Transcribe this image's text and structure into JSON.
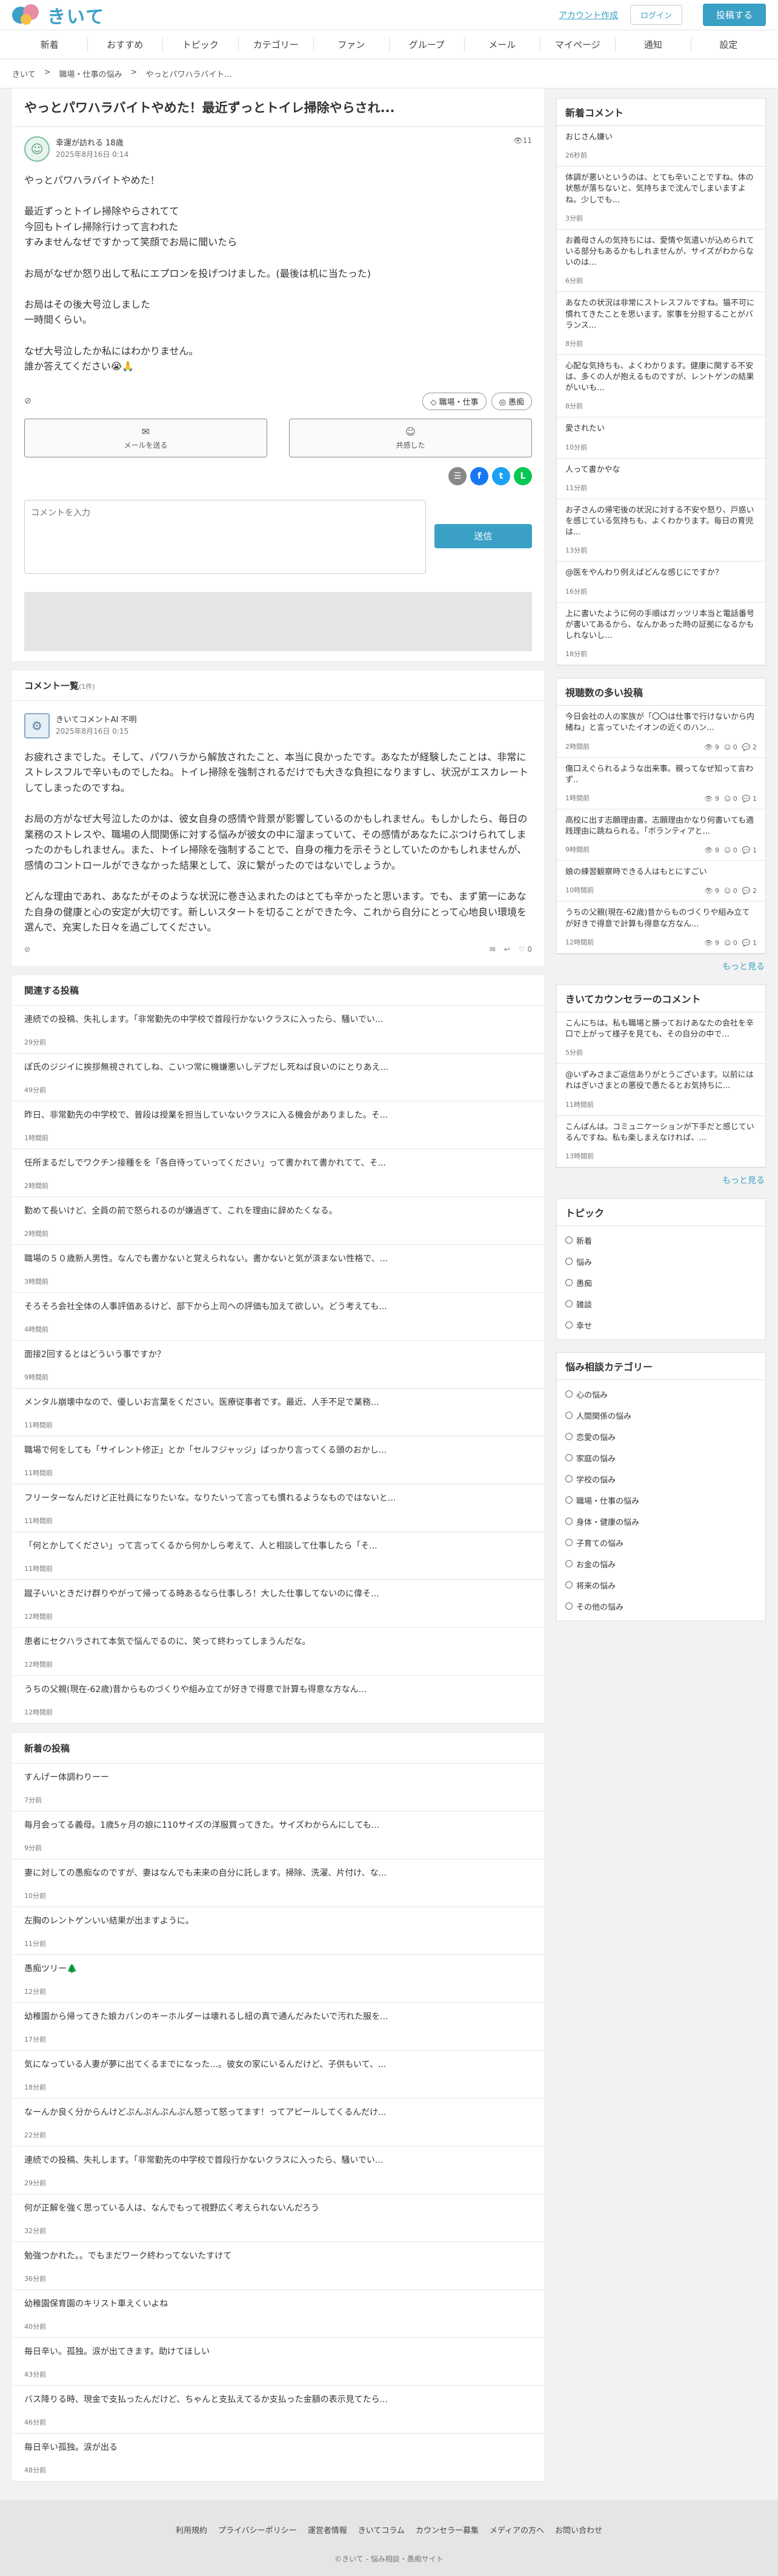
{
  "header": {
    "logo": "きいて",
    "signup": "アカウント作成",
    "login": "ログイン",
    "post": "投稿する"
  },
  "nav": [
    "新着",
    "おすすめ",
    "トピック",
    "カテゴリー",
    "ファン",
    "グループ",
    "メール",
    "マイページ",
    "通知",
    "設定"
  ],
  "breadcrumb": [
    "きいて",
    ">",
    "職場・仕事の悩み",
    ">",
    "やっとパワハラバイト..."
  ],
  "post": {
    "title": "やっとパワハラバイトやめた！最近ずっとトイレ掃除やらされ...",
    "author": "幸運が訪れる",
    "age": "18歳",
    "date": "2025年8月16日 0:14",
    "views": "11",
    "body": "やっとパワハラバイトやめた！\n\n最近ずっとトイレ掃除やらされてて\n今回もトイレ掃除行けって言われた\nすみませんなぜですかって笑顔でお局に聞いたら\n\nお局がなぜか怒り出して私にエプロンを投げつけました。(最後は机に当たった)\n\nお局はその後大号泣しました\n一時間くらい。\n\nなぜ大号泣したか私にはわかりません。\n誰か答えてください😭🙏",
    "tags": [
      "職場・仕事",
      "愚痴"
    ],
    "mail": "メールを送る",
    "empathy": "共感した",
    "placeholder": "コメントを入力",
    "send": "送信"
  },
  "comments": {
    "title": "コメント一覧",
    "count": "(1件)",
    "items": [
      {
        "author": "きいてコメントAI",
        "age": "不明",
        "date": "2025年8月16日 0:15",
        "body": "お疲れさまでした。そして、パワハラから解放されたこと、本当に良かったです。あなたが経験したことは、非常にストレスフルで辛いものでしたね。トイレ掃除を強制されるだけでも大きな負担になりますし、状況がエスカレートしてしまったのですね。\n\nお局の方がなぜ大号泣したのかは、彼女自身の感情や背景が影響しているのかもしれません。もしかしたら、毎日の業務のストレスや、職場の人間関係に対する悩みが彼女の中に溜まっていて、その感情があなたにぶつけられてしまったのかもしれません。また、トイレ掃除を強制することで、自身の権力を示そうとしていたのかもしれませんが、感情のコントロールができなかった結果として、涙に繋がったのではないでしょうか。\n\nどんな理由であれ、あなたがそのような状況に巻き込まれたのはとても辛かったと思います。でも、まず第一にあなた自身の健康と心の安定が大切です。新しいスタートを切ることができた今、これから自分にとって心地良い環境を選んで、充実した日々を過ごしてください。",
        "likes": "0"
      }
    ]
  },
  "related": {
    "title": "関連する投稿",
    "items": [
      {
        "text": "連続での投稿、失礼します。「非常勤先の中学校で首段行かないクラスに入ったら、騒いでい...",
        "time": "29分前"
      },
      {
        "text": "ぽ氏のジジイに挨拶無視されてしね、こいつ常に機嫌悪いしデブだし死ねば良いのにとりあえ...",
        "time": "49分前"
      },
      {
        "text": "昨日、非常勤先の中学校で、普段は授業を担当していないクラスに入る機会がありました。そ...",
        "time": "1時間前"
      },
      {
        "text": "任所まるだしでワクチン接種をを「各自待っていってください」って書かれて書かれてて、そ...",
        "time": "2時間前"
      },
      {
        "text": "勤めて長いけど、全員の前で怒られるのが嫌過ぎて、これを理由に辞めたくなる。",
        "time": "2時間前"
      },
      {
        "text": "職場の５０歳新人男性。なんでも書かないと覚えられない。書かないと気が済まない性格で、...",
        "time": "3時間前"
      },
      {
        "text": "そろそろ会社全体の人事評価あるけど、部下から上司への評価も加えて欲しい。どう考えても...",
        "time": "4時間前"
      },
      {
        "text": "面接2回するとはどういう事ですか？",
        "time": "9時間前"
      },
      {
        "text": "メンタル崩壊中なので、優しいお言葉をください。医療従事者です。最近、人手不足で業務...",
        "time": "11時間前"
      },
      {
        "text": "職場で何をしても「サイレント修正」とか「セルフジャッジ」ばっかり言ってくる頭のおかし...",
        "time": "11時間前"
      },
      {
        "text": "フリーターなんだけど正社員になりたいな。なりたいって言っても慣れるようなものではないと...",
        "time": "11時間前"
      },
      {
        "text": "「何とかしてください」って言ってくるから何かしら考えて、人と相談して仕事したら「そ...",
        "time": "11時間前"
      },
      {
        "text": "蹴子いいときだけ群りやがって帰ってる時あるなら仕事しろ！大した仕事してないのに偉そ...",
        "time": "12時間前"
      },
      {
        "text": "患者にセクハラされて本気で悩んでるのに、笑って終わってしまうんだな。",
        "time": "12時間前"
      },
      {
        "text": "うちの父親(現在-62歳)昔からものづくりや組み立てが好きで得意で計算も得意な方なん...",
        "time": "12時間前"
      }
    ]
  },
  "newposts": {
    "title": "新着の投稿",
    "items": [
      {
        "text": "すんげー体調わりーー",
        "time": "7分前"
      },
      {
        "text": "毎月会ってる義母。1歳5ヶ月の娘に110サイズの洋服買ってきた。サイズわからんにしても...",
        "time": "9分前"
      },
      {
        "text": "妻に対しての愚痴なのですが、妻はなんでも未来の自分に託します。掃除、洗濯、片付け、な...",
        "time": "10分前"
      },
      {
        "text": "左胸のレントゲンいい結果が出ますように。",
        "time": "11分前"
      },
      {
        "text": "愚痴ツリー🌲",
        "time": "12分前"
      },
      {
        "text": "幼稚園から帰ってきた娘カバンのキーホルダーは壊れるし紐の真で通んだみたいで汚れた服を...",
        "time": "17分前"
      },
      {
        "text": "気になっている人妻が夢に出てくるまでになった...。彼女の家にいるんだけど、子供もいて、...",
        "time": "18分前"
      },
      {
        "text": "なーんか良く分からんけどぷんぷんぷんぷん怒って怒ってます！ってアピールしてくるんだけ...",
        "time": "22分前"
      },
      {
        "text": "連続での投稿、失礼します。「非常勤先の中学校で首段行かないクラスに入ったら、騒いでい...",
        "time": "29分前"
      },
      {
        "text": "何が正解を強く思っている人は、なんでもって視野広く考えられないんだろう",
        "time": "32分前"
      },
      {
        "text": "勉強つかれた。。でもまだワーク終わってないたすけて",
        "time": "36分前"
      },
      {
        "text": "幼稚園保育園のキリスト車えくいよね",
        "time": "40分前"
      },
      {
        "text": "毎日辛い。孤独。涙が出てきます。助けてほしい",
        "time": "43分前"
      },
      {
        "text": "バス降りる時、現金で支払ったんだけど、ちゃんと支払えてるか支払った金額の表示見てたら...",
        "time": "46分前"
      },
      {
        "text": "毎日辛い孤独。涙が出る",
        "time": "48分前"
      }
    ]
  },
  "side": {
    "newcomments": {
      "title": "新着コメント",
      "items": [
        {
          "text": "おじさん嫌い",
          "date": "26秒前"
        },
        {
          "text": "体調が悪いというのは、とても辛いことですね。体の状態が落ちないと、気持ちまで沈んでしまいますよね。少しでも...",
          "date": "3分前"
        },
        {
          "text": "お義母さんの気持ちには、愛情や気遣いが込められている部分もあるかもしれませんが、サイズがわからないのは...",
          "date": "6分前"
        },
        {
          "text": "あなたの状況は非常にストレスフルですね。猫不可に慣れてきたことを思います。家事を分担することがバランス...",
          "date": "8分前"
        },
        {
          "text": "心配な気持ちも、よくわかります。健康に関する不安は、多くの人が抱えるものですが、レントゲンの結果がいいも...",
          "date": "8分前"
        },
        {
          "text": "愛されたい",
          "date": "10分前"
        },
        {
          "text": "人って書かやな",
          "date": "11分前"
        },
        {
          "text": "お子さんの帰宅後の状況に対する不安や怒り、戸惑いを感じている気持ちも、よくわかります。毎日の育児は...",
          "date": "13分前"
        },
        {
          "text": "@医をやんわり例えばどんな感じにですか？",
          "date": "16分前"
        },
        {
          "text": "上に書いたように何の手順はガッツリ本当と電話番号が書いてあるから、なんかあった時の証拠になるかもしれないし...",
          "date": "18分前"
        }
      ]
    },
    "viewed": {
      "title": "視聴数の多い投稿",
      "more": "もっと見る",
      "items": [
        {
          "text": "今日会社の人の家族が「〇〇は仕事で行けないから内緒ね」と言っていたイオンの近くのハン...",
          "date": "2時間前",
          "v": "9",
          "e": "0",
          "c": "2"
        },
        {
          "text": "傷口えぐられるような出来事。親ってなぜ知って言わず..",
          "date": "1時間前",
          "v": "9",
          "e": "0",
          "c": "1"
        },
        {
          "text": "高校に出す志願理由書。志願理由かなり何書いても適践理由に跳ねられる。「ボランティアと...",
          "date": "9時間前",
          "v": "9",
          "e": "0",
          "c": "1"
        },
        {
          "text": "娘の練習観察時できる人はもとにすごい",
          "date": "10時間前",
          "v": "9",
          "e": "0",
          "c": "2"
        },
        {
          "text": "うちの父親(現在-62歳)昔からものづくりや組み立てが好きで得意で計算も得意な方なん...",
          "date": "12時間前",
          "v": "9",
          "e": "0",
          "c": "1"
        }
      ]
    },
    "counselor": {
      "title": "きいてカウンセラーのコメント",
      "more": "もっと見る",
      "items": [
        {
          "text": "こんにちは。私も職場と勝っておけあなたの会社を辛口で上がって様子を見ても、その自分の中で...",
          "date": "5分前"
        },
        {
          "text": "@いずみさまご返信ありがとうございます。以前にはれはぎいさまとの悪役で愚たるとお気持ちに...",
          "date": "11時間前"
        },
        {
          "text": "こんばんは。コミュニケーションが下手だと感じているんですね。私も楽しまえなければ、...",
          "date": "13時間前"
        }
      ]
    },
    "topics": {
      "title": "トピック",
      "items": [
        "新着",
        "悩み",
        "愚痴",
        "雑談",
        "幸せ"
      ]
    },
    "categories": {
      "title": "悩み相談カテゴリー",
      "items": [
        "心の悩み",
        "人間関係の悩み",
        "恋愛の悩み",
        "家庭の悩み",
        "学校の悩み",
        "職場・仕事の悩み",
        "身体・健康の悩み",
        "子育ての悩み",
        "お金の悩み",
        "将来の悩み",
        "その他の悩み"
      ]
    }
  },
  "footer": {
    "links": [
      "利用規約",
      "プライバシーポリシー",
      "運営者情報",
      "きいてコラム",
      "カウンセラー募集",
      "メディアの方へ",
      "お問い合わせ"
    ],
    "copy": "©きいて - 悩み相談・愚痴サイト"
  }
}
